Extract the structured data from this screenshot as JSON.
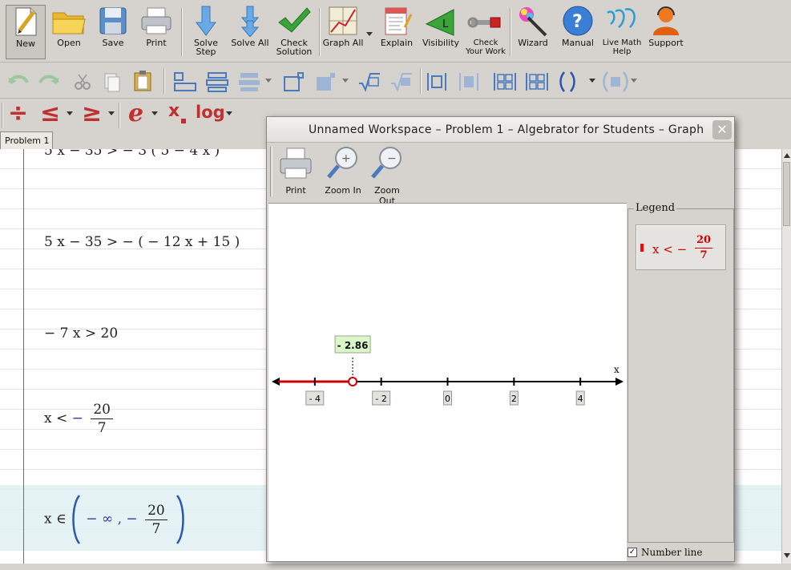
{
  "toolbar": {
    "buttons": [
      {
        "id": "new",
        "label": "New"
      },
      {
        "id": "open",
        "label": "Open"
      },
      {
        "id": "save",
        "label": "Save"
      },
      {
        "id": "print",
        "label": "Print"
      },
      {
        "id": "solve_step",
        "label": "Solve\nStep"
      },
      {
        "id": "solve_all",
        "label": "Solve All"
      },
      {
        "id": "check_solution",
        "label": "Check\nSolution"
      },
      {
        "id": "graph_all",
        "label": "Graph All"
      },
      {
        "id": "explain",
        "label": "Explain"
      },
      {
        "id": "visibility",
        "label": "Visibility"
      },
      {
        "id": "check_work",
        "label": "Check\nYour Work"
      },
      {
        "id": "wizard",
        "label": "Wizard"
      },
      {
        "id": "manual",
        "label": "Manual"
      },
      {
        "id": "live_help",
        "label": "Live Math\nHelp"
      },
      {
        "id": "support",
        "label": "Support"
      }
    ]
  },
  "math_toolbar": {
    "divide": "÷",
    "leq": "≤",
    "geq": "≥",
    "e": "e",
    "subscript": "x",
    "log": "log"
  },
  "tabs": [
    "Problem 1"
  ],
  "worksheet": {
    "steps": [
      {
        "text": "5 x − 35 > − 3 ( 5 − 4 x )"
      },
      {
        "text": "5 x − 35 > − ( − 12 x + 15 )"
      },
      {
        "text": "− 7 x > 20"
      },
      {
        "lhs": "x <",
        "sign": "−",
        "num": "20",
        "den": "7"
      },
      {
        "lhs": "x ∈",
        "interval_left": "− ∞ ,",
        "sign": "−",
        "num": "20",
        "den": "7"
      }
    ]
  },
  "graph_window": {
    "title": "Unnamed Workspace – Problem 1 – Algebrator for Students – Graph",
    "close": "✕",
    "tools": [
      {
        "id": "print",
        "label": "Print"
      },
      {
        "id": "zoom_in",
        "label": "Zoom In"
      },
      {
        "id": "zoom_out",
        "label": "Zoom Out"
      }
    ],
    "legend": {
      "caption": "Legend",
      "entry": {
        "text": "x < −",
        "num": "20",
        "den": "7",
        "color": "#cc0000"
      }
    },
    "number_line_option": {
      "label": "Number line",
      "checked": true,
      "mark": "✓"
    }
  },
  "chart_data": {
    "type": "number_line",
    "axis_label": "x",
    "ticks": [
      -4,
      -2,
      0,
      2,
      4
    ],
    "tick_labels": [
      "- 4",
      "- 2",
      "0",
      "2",
      "4"
    ],
    "xlim": [
      -5.3,
      5.3
    ],
    "boundary": {
      "value": -2.86,
      "label": "- 2.86",
      "open": true
    },
    "shaded": {
      "from": "-inf",
      "to": -2.86,
      "color": "#cc0000"
    }
  }
}
